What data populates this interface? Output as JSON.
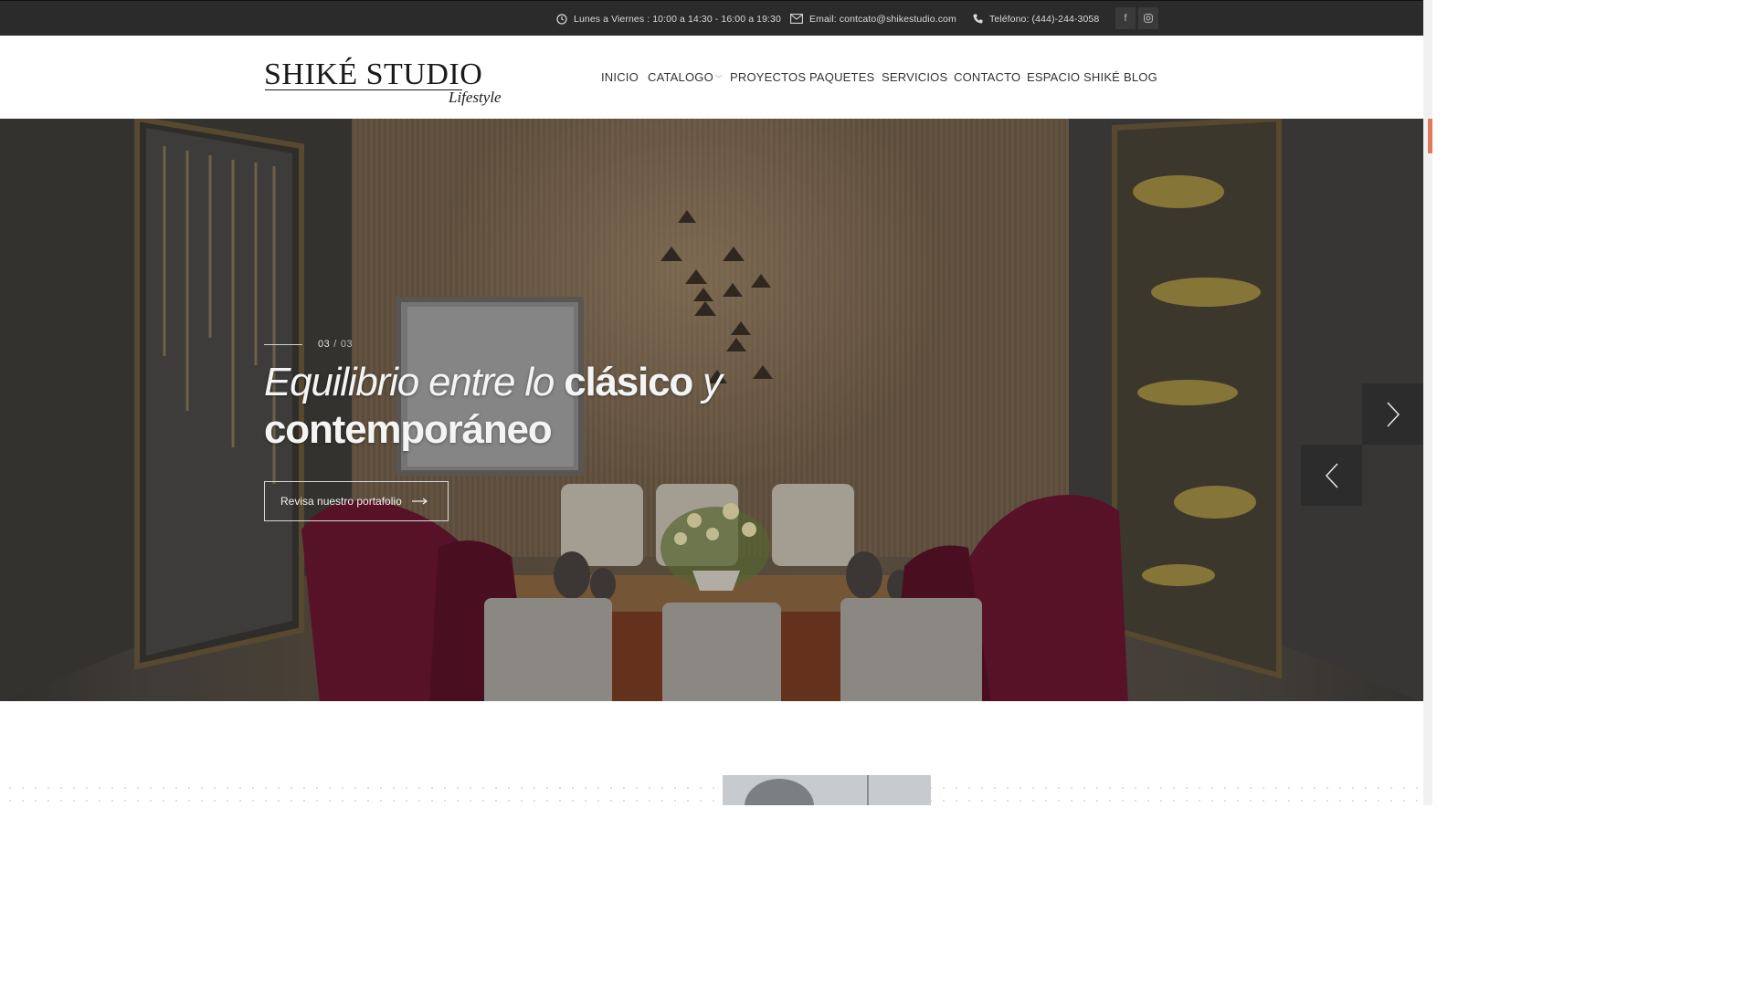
{
  "topbar": {
    "hours": "Lunes a Viernes : 10:00 a 14:30 - 16:00 a 19:30",
    "email": "Email: contcato@shikestudio.com",
    "phone": "Teléfono: (444)-244-3058",
    "social": [
      {
        "icon": "facebook-icon",
        "label": "f"
      },
      {
        "icon": "instagram-icon",
        "label": "◎"
      }
    ]
  },
  "logo": {
    "main": "SHIKÉ STUDIO",
    "sub": "Lifestyle"
  },
  "nav": {
    "items": [
      {
        "label": "INICIO"
      },
      {
        "label": "CATALOGO",
        "has_dropdown": true
      },
      {
        "label": "PROYECTOS"
      },
      {
        "label": "PAQUETES"
      },
      {
        "label": "SERVICIOS"
      },
      {
        "label": "CONTACTO"
      },
      {
        "label": "ESPACIO SHIKÉ"
      },
      {
        "label": "BLOG"
      }
    ]
  },
  "hero": {
    "slide_current": "03",
    "slide_separator": "/",
    "slide_total": "03",
    "headline_part1": "Equilibrio entre lo ",
    "headline_bold1": "clásico",
    "headline_part2": " y ",
    "headline_bold2": "contemporáneo",
    "cta_label": "Revisa nuestro portafolio",
    "cta_arrow": "⟶",
    "next_icon": "chevron-right-icon",
    "prev_icon": "chevron-left-icon"
  },
  "colors": {
    "topbar_bg": "#2b2b2b",
    "accent": "#e2795a",
    "arrow_bg": "#2c2c2c"
  }
}
